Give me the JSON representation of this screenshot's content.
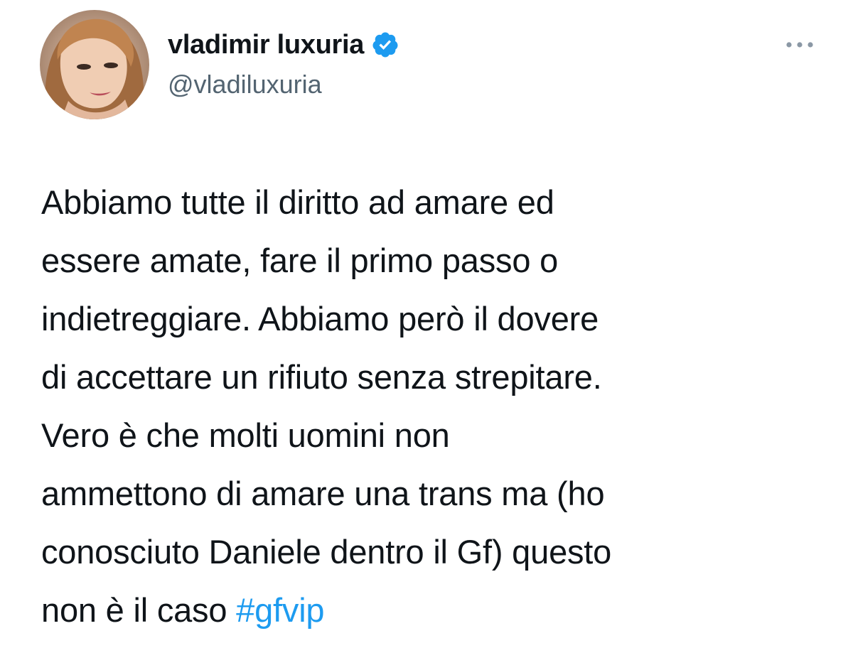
{
  "author": {
    "display_name": "vladimir luxuria",
    "handle": "@vladiluxuria",
    "verified": true,
    "avatar_icon": "profile-photo",
    "verified_icon": "verified-badge-icon"
  },
  "menu": {
    "icon": "more-horizontal-icon"
  },
  "tweet": {
    "lines": [
      "Abbiamo tutte il diritto ad amare ed",
      "essere amate, fare il primo passo o",
      "indietreggiare. Abbiamo però il dovere",
      "di accettare un rifiuto senza strepitare.",
      "Vero è che molti uomini non",
      "ammettono di amare una trans ma (ho",
      "conosciuto Daniele dentro il Gf) questo"
    ],
    "last_line_text": "non è il caso ",
    "hashtag": "#gfvip"
  },
  "colors": {
    "text": "#0f1419",
    "secondary": "#536471",
    "accent": "#1d9bf0"
  }
}
